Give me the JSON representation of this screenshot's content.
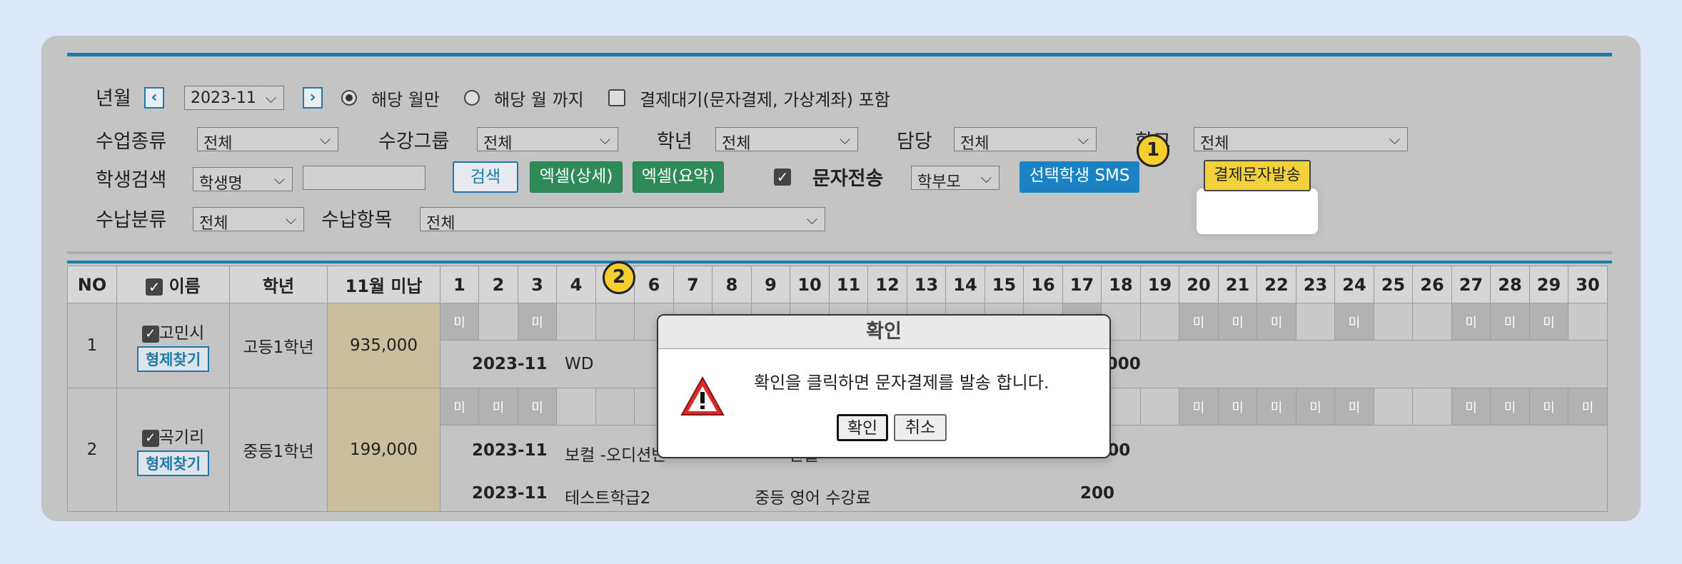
{
  "filters": {
    "year_month_label": "년월",
    "year_month_value": "2023-11",
    "radio_this_month": "해당 월만",
    "radio_until_month": "해당 월 까지",
    "pending_checkbox": "결제대기(문자결제, 가상계좌) 포함",
    "class_type_label": "수업종류",
    "class_type_value": "전체",
    "course_group_label": "수강그룹",
    "course_group_value": "전체",
    "grade_label": "학년",
    "grade_value": "전체",
    "teacher_label": "담당",
    "teacher_value": "전체",
    "school_label": "학교",
    "school_value": "전체",
    "student_search_label": "학생검색",
    "student_search_field": "학생명",
    "search_button": "검색",
    "excel_detail_button": "엑셀(상세)",
    "excel_summary_button": "엑셀(요약)",
    "sms_checkbox_label": "문자전송",
    "sms_target_value": "학부모",
    "selected_sms_button": "선택학생 SMS",
    "payment_sms_button": "결제문자발송",
    "payment_category_label": "수납분류",
    "payment_category_value": "전체",
    "payment_item_label": "수납항목",
    "payment_item_value": "전체"
  },
  "markers": [
    "1",
    "2"
  ],
  "table": {
    "headers": {
      "no": "NO",
      "name": "이름",
      "grade": "학년",
      "unpaid": "11월 미납"
    },
    "days": [
      "1",
      "2",
      "3",
      "4",
      "5",
      "6",
      "7",
      "8",
      "9",
      "10",
      "11",
      "12",
      "13",
      "14",
      "15",
      "16",
      "17",
      "18",
      "19",
      "20",
      "21",
      "22",
      "23",
      "24",
      "25",
      "26",
      "27",
      "28",
      "29",
      "30"
    ],
    "day_mark": "미",
    "rows": [
      {
        "no": "1",
        "name": "고민시",
        "sibling_button": "형제찾기",
        "grade": "고등1학년",
        "unpaid": "935,000",
        "details": [
          {
            "month": "2023-11",
            "item": "WD",
            "type": "",
            "amount": "935,000"
          }
        ]
      },
      {
        "no": "2",
        "name": "곡기리",
        "sibling_button": "형제찾기",
        "grade": "중등1학년",
        "unpaid": "199,000",
        "details": [
          {
            "month": "2023-11",
            "item": "보컬 -오디션반",
            "type": "환불",
            "amount": "-1,000"
          },
          {
            "month": "2023-11",
            "item": "테스트학급2",
            "type": "중등 영어 수강료",
            "amount": "200"
          }
        ]
      }
    ]
  },
  "dialog": {
    "title": "확인",
    "message": "확인을 클릭하면 문자결제를 발송 합니다.",
    "ok": "확인",
    "cancel": "취소"
  }
}
